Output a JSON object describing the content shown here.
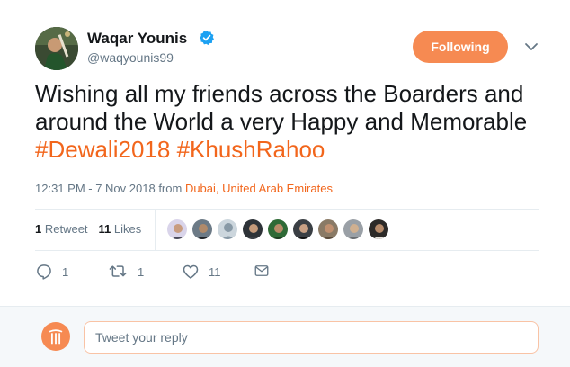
{
  "user": {
    "name": "Waqar Younis",
    "handle": "@waqyounis99",
    "verified": true
  },
  "follow_button": {
    "label": "Following"
  },
  "tweet": {
    "text_plain": "Wishing all my friends across the Boarders and around the World a very Happy and Memorable ",
    "hashtags": [
      "#Dewali2018",
      "#KhushRahoo"
    ]
  },
  "meta": {
    "time": "12:31 PM - 7 Nov 2018",
    "from_label": " from ",
    "location": "Dubai, United Arab Emirates"
  },
  "stats": {
    "retweets_count": "1",
    "retweets_label": " Retweet",
    "likes_count": "11",
    "likes_label": " Likes"
  },
  "likers_count_shown": 9,
  "actions": {
    "reply_count": "1",
    "retweet_count": "1",
    "like_count": "11"
  },
  "reply": {
    "placeholder": "Tweet your reply"
  },
  "colors": {
    "accent": "#f2661c",
    "button": "#f68a52",
    "secondary_text": "#657786"
  },
  "icons": {
    "verified": "verified-badge-icon",
    "caret": "chevron-down-icon",
    "reply": "reply-icon",
    "retweet": "retweet-icon",
    "like": "heart-icon",
    "dm": "envelope-icon"
  }
}
